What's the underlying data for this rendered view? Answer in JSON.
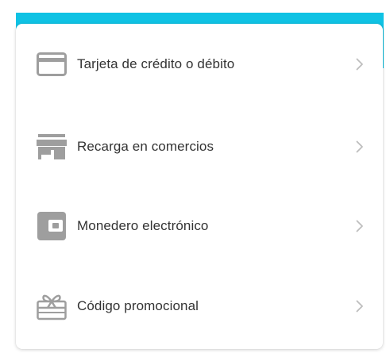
{
  "colors": {
    "header_band": "#0fc2e4",
    "icon": "#9e9e9e",
    "label": "#333333",
    "chevron": "#bdbdbd"
  },
  "payment_methods": [
    {
      "label": "Tarjeta de crédito o débito",
      "icon": "credit-card-icon"
    },
    {
      "label": "Recarga en comercios",
      "icon": "store-icon"
    },
    {
      "label": "Monedero electrónico",
      "icon": "wallet-icon"
    },
    {
      "label": "Código promocional",
      "icon": "gift-card-icon"
    }
  ]
}
